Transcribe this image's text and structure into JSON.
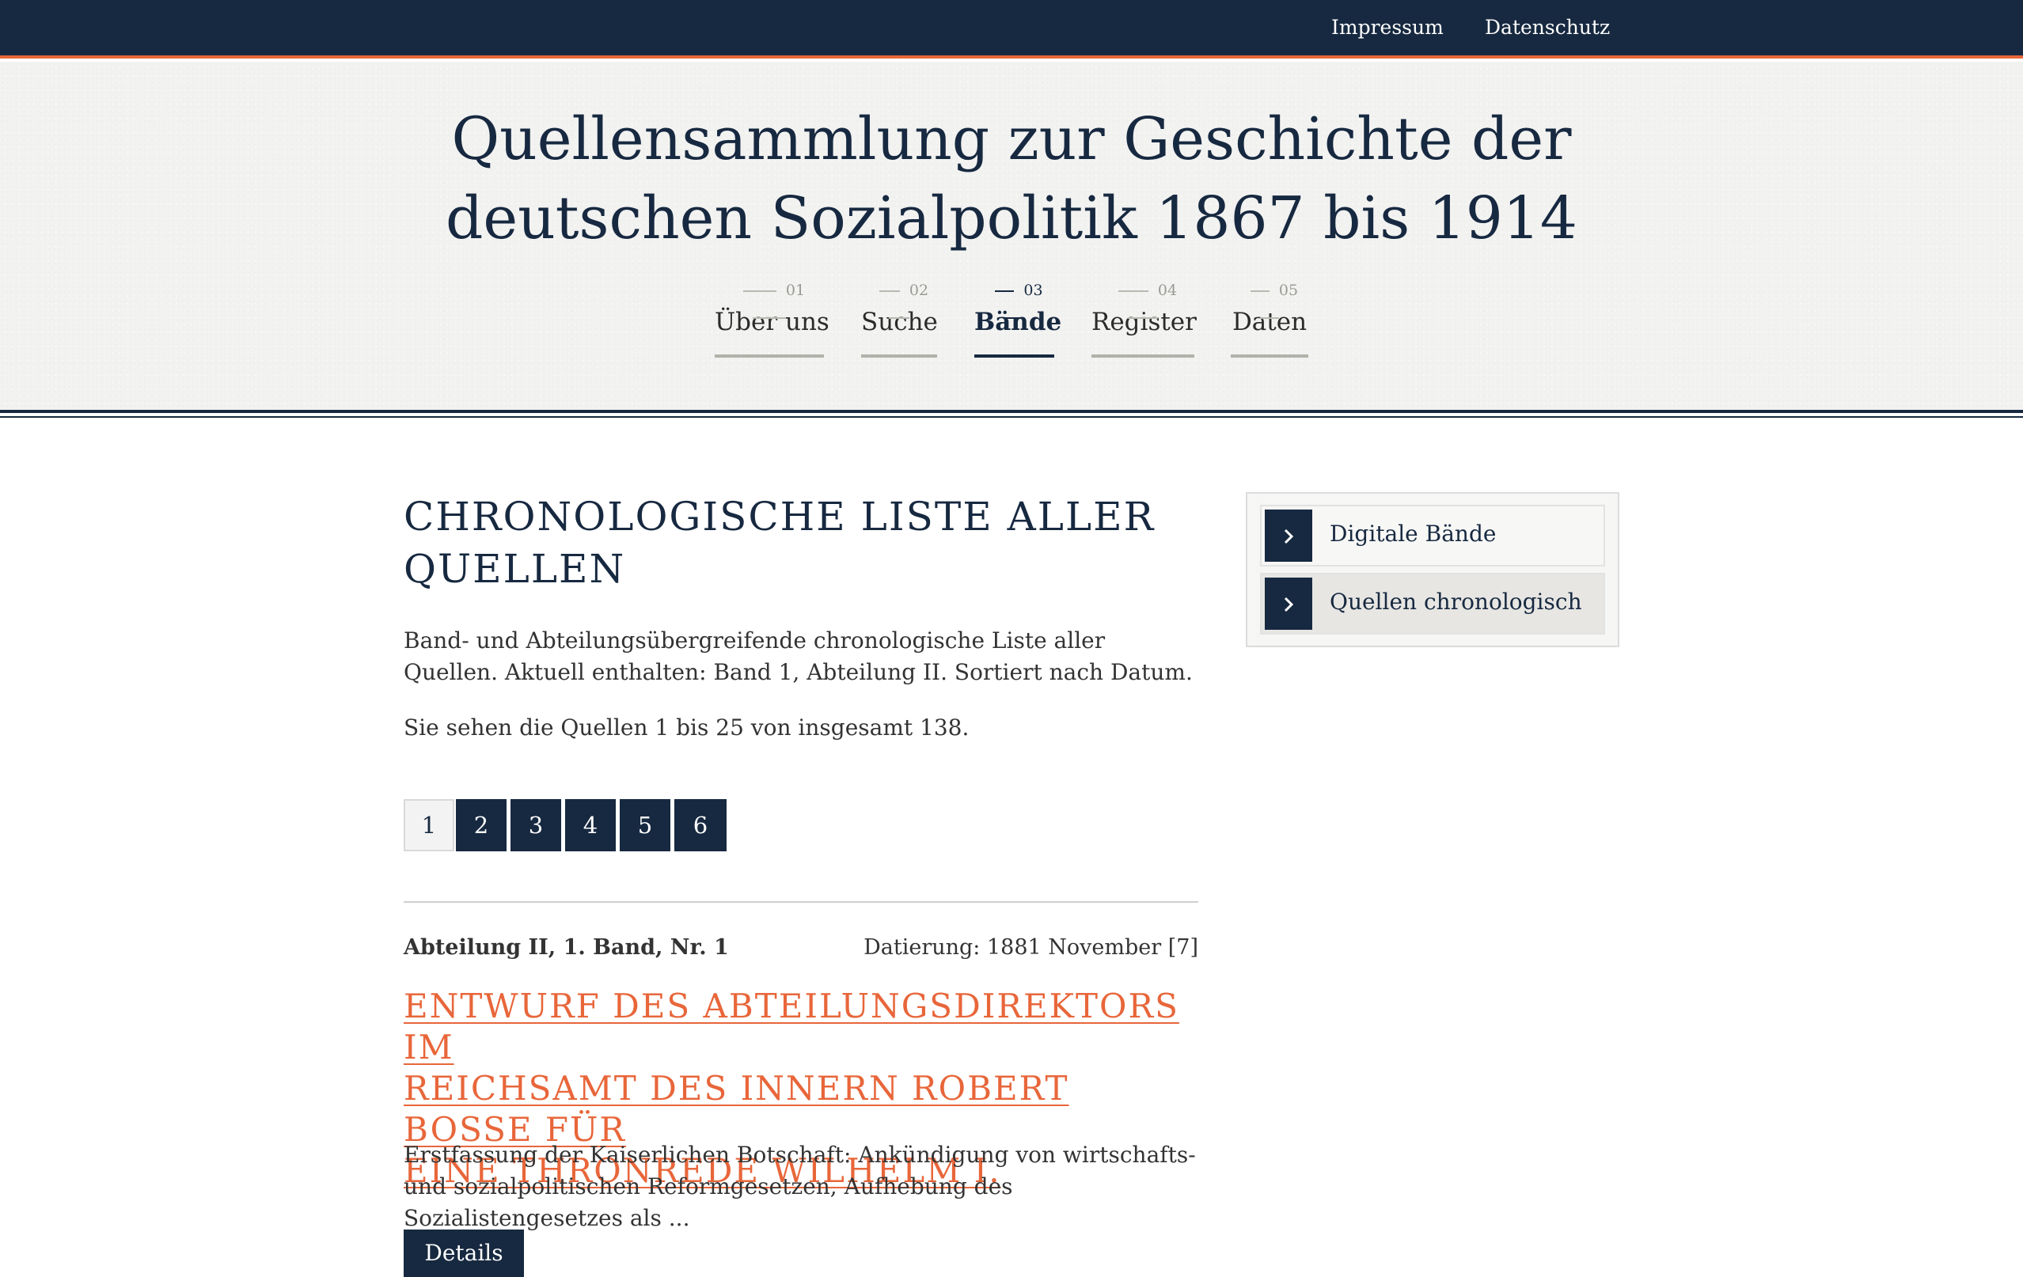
{
  "topbar": {
    "links": [
      "Impressum",
      "Datenschutz"
    ]
  },
  "header": {
    "title_lines": [
      "Quellensammlung zur Geschichte der",
      "deutschen Sozialpolitik 1867 bis 1914"
    ]
  },
  "nav": {
    "active_index": 2,
    "items": [
      {
        "num": "01",
        "label": "Über uns"
      },
      {
        "num": "02",
        "label": "Suche"
      },
      {
        "num": "03",
        "label": "Bände"
      },
      {
        "num": "04",
        "label": "Register"
      },
      {
        "num": "05",
        "label": "Daten"
      }
    ]
  },
  "main": {
    "heading_lines": [
      "CHRONOLOGISCHE LISTE ALLER",
      "QUELLEN"
    ],
    "intro": "Band- und Abteilungsübergreifende chronologische Liste aller Quellen. Aktuell enthalten: Band 1, Abteilung II. Sortiert nach Datum.",
    "count": "Sie sehen die Quellen 1 bis 25 von insgesamt 138."
  },
  "pagination": {
    "current": "1",
    "pages": [
      "1",
      "2",
      "3",
      "4",
      "5",
      "6"
    ]
  },
  "entry": {
    "ref": "Abteilung II, 1. Band, Nr. 1",
    "date": "Datierung: 1881 November [7]",
    "title_lines": [
      "ENTWURF DES ABTEILUNGSDIREKTORS IM",
      "REICHSAMT DES INNERN ROBERT BOSSE FÜR",
      "EINE THRONREDE WILHELM I."
    ],
    "excerpt": "Erstfassung der Kaiserlichen Botschaft: Ankündigung von wirtschafts- und sozialpolitischen Reformgesetzen, Aufhebung des Sozialistengesetzes als ...",
    "details_label": "Details"
  },
  "sidebar": {
    "active_index": 1,
    "items": [
      {
        "label": "Digitale Bände",
        "icon": "chevron-right-icon"
      },
      {
        "label": "Quellen chronologisch",
        "icon": "chevron-right-icon"
      }
    ]
  },
  "colors": {
    "navy": "#172940",
    "accent": "#e8663a",
    "header_bg": "#f2f2f1"
  }
}
